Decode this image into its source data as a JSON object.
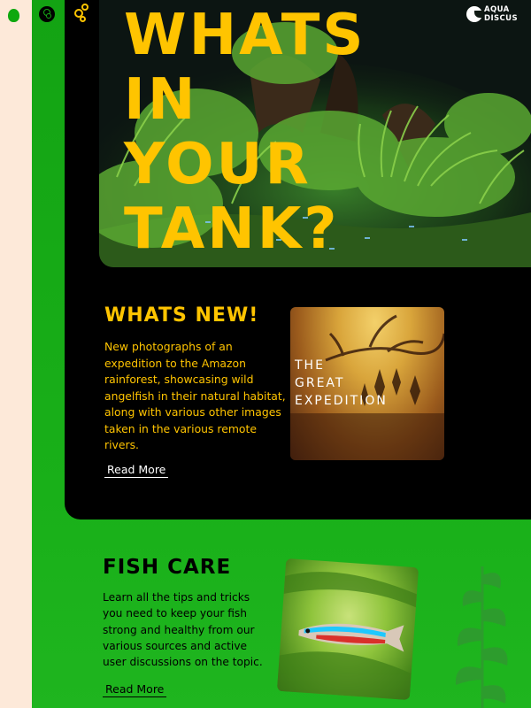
{
  "hero": {
    "title": "WHATS\nIN\nYOUR\nTANK?"
  },
  "logo": {
    "text": "AQUA\nDISCUS"
  },
  "news": {
    "title": "WHATS NEW!",
    "text": "New photographs of an expedition to the Amazon rainforest, showcasing wild angelfish in their natural habitat, along with various other images taken in the various remote rivers.",
    "read_more": "Read More",
    "card_text": "THE\nGREAT\nEXPEDITION"
  },
  "care": {
    "title": "FISH CARE",
    "text": "Learn all the tips and tricks you need to keep your fish strong and healthy from our various sources and active user discussions on the topic.",
    "read_more": "Read More"
  },
  "colors": {
    "accent": "#ffc400",
    "green": "#16a816",
    "dark": "#000000",
    "cream": "#fde9d9"
  },
  "icons": [
    "menu-icon",
    "bubbles-icon",
    "logo-icon",
    "plant-icon"
  ]
}
